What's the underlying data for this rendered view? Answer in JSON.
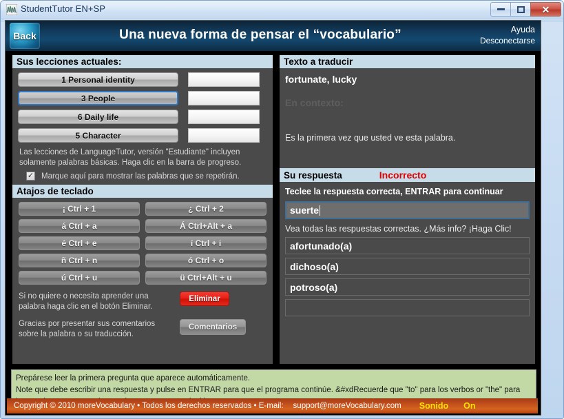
{
  "window": {
    "title": "StudentTutor EN+SP",
    "icon": "app-logo-icon",
    "minimize_label": "–",
    "maximize_label": "□",
    "close_label": "✕"
  },
  "header": {
    "back_label": "Back",
    "title": "Una nueva forma de pensar el “vocabulario”",
    "help_label": "Ayuda",
    "logout_label": "Desconectarse"
  },
  "left_panel": {
    "lessons_header": "Sus lecciones actuales:",
    "lessons": [
      {
        "label": "1 Personal identity",
        "selected": false,
        "progress": ""
      },
      {
        "label": "3 People",
        "selected": true,
        "progress": ""
      },
      {
        "label": "6 Daily life",
        "selected": false,
        "progress": ""
      },
      {
        "label": "5 Character",
        "selected": false,
        "progress": ""
      }
    ],
    "lessons_note": "Las lecciones de LanguageTutor, versión \"Estudiante\" incluyen solamente palabras básicas. Haga clic en la barra de progreso.",
    "repeat_checkbox": {
      "checked": true,
      "check_glyph": "✓",
      "label": "Marque aquí para mostrar las palabras que se repetirán."
    },
    "shortcuts_header": "Atajos de teclado",
    "shortcuts": [
      "¡ Ctrl + 1",
      "¿ Ctrl + 2",
      "á Ctrl + a",
      "Á Ctrl+Alt + a",
      "é Ctrl + e",
      "í Ctrl + i",
      "ñ Ctrl + n",
      "ó Ctrl + o",
      "ú Ctrl + u",
      "ü Ctrl+Alt + u"
    ],
    "delete_note": "Si no quiere o necesita aprender una palabra haga clic en el botón Eliminar.",
    "delete_button": "Eliminar",
    "feedback_note": "Gracias por presentar sus comentarios sobre la palabra o su traducción.",
    "feedback_button": "Comentarios"
  },
  "right_panel": {
    "translate_header": "Texto a traducir",
    "word": "fortunate, lucky",
    "context_label": "En contexto:",
    "first_time_text": "Es la primera vez que usted ve esta palabra.",
    "answer_header": "Su respuesta",
    "verdict": "Incorrecto",
    "instruction": "Teclee la respuesta correcta, ENTRAR para continuar",
    "answer_value": "suerte",
    "see_all_text": "Vea todas las respuestas correctas. ¿Más info? ¡Haga Clic!",
    "correct_answers": [
      "afortunado(a)",
      "dichoso(a)",
      "potroso(a)",
      ""
    ]
  },
  "message_box": {
    "line1": "Prepárese leer la primera pregunta que aparece automáticamente.",
    "line2": "Note que debe escribir una respuesta y pulse en ENTRAR para que el programa continúe. &#xdRecuerde que \"to\" para los verbos or \"the\" para los nombres no se requiere en las respuestas en inglés."
  },
  "footer": {
    "copyright": "Copyright © 2010 moreVocabulary • Todos los derechos reservados • E-mail:",
    "email": "support@moreVocabulary.com",
    "sound_label": "Sonido",
    "sound_state": "On"
  },
  "colors": {
    "header_blue": "#14486f",
    "section_header": "#c6dce8",
    "panel_bg": "#4a4a4a",
    "verdict_red": "#e00000",
    "delete_red": "#e81e12",
    "footer_orange": "#c4501d",
    "message_green": "#c2d9a5",
    "sound_yellow": "#ffe200",
    "selected_border": "#2f79c4"
  }
}
